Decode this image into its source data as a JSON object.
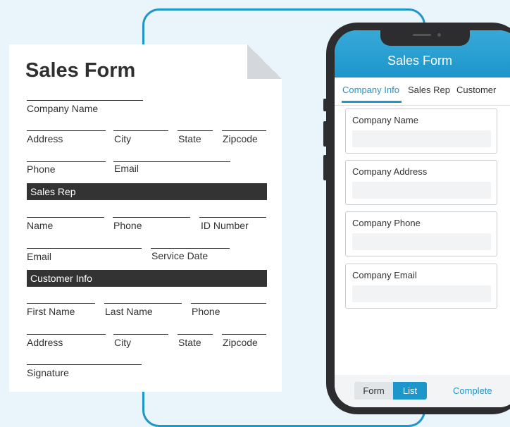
{
  "paper_form": {
    "title": "Sales Form",
    "company_name": "Company Name",
    "address": "Address",
    "city": "City",
    "state": "State",
    "zipcode": "Zipcode",
    "phone": "Phone",
    "email": "Email",
    "sales_rep_header": "Sales Rep",
    "name": "Name",
    "rep_phone": "Phone",
    "id_number": "ID Number",
    "rep_email": "Email",
    "service_date": "Service Date",
    "customer_info_header": "Customer Info",
    "first_name": "First Name",
    "last_name": "Last Name",
    "cust_phone": "Phone",
    "cust_address": "Address",
    "cust_city": "City",
    "cust_state": "State",
    "cust_zipcode": "Zipcode",
    "signature": "Signature"
  },
  "phone_app": {
    "title": "Sales Form",
    "tabs": [
      {
        "label": "Company Info",
        "active": true
      },
      {
        "label": "Sales Rep",
        "active": false
      },
      {
        "label": "Customer",
        "active": false
      }
    ],
    "fields": [
      {
        "label": "Company Name",
        "value": ""
      },
      {
        "label": "Company Address",
        "value": ""
      },
      {
        "label": "Company Phone",
        "value": ""
      },
      {
        "label": "Company Email",
        "value": ""
      }
    ],
    "bottom": {
      "form_label": "Form",
      "list_label": "List",
      "complete_label": "Complete"
    }
  },
  "colors": {
    "accent": "#1f97c9",
    "background": "#eaf5fb",
    "dark_bar": "#333333"
  }
}
